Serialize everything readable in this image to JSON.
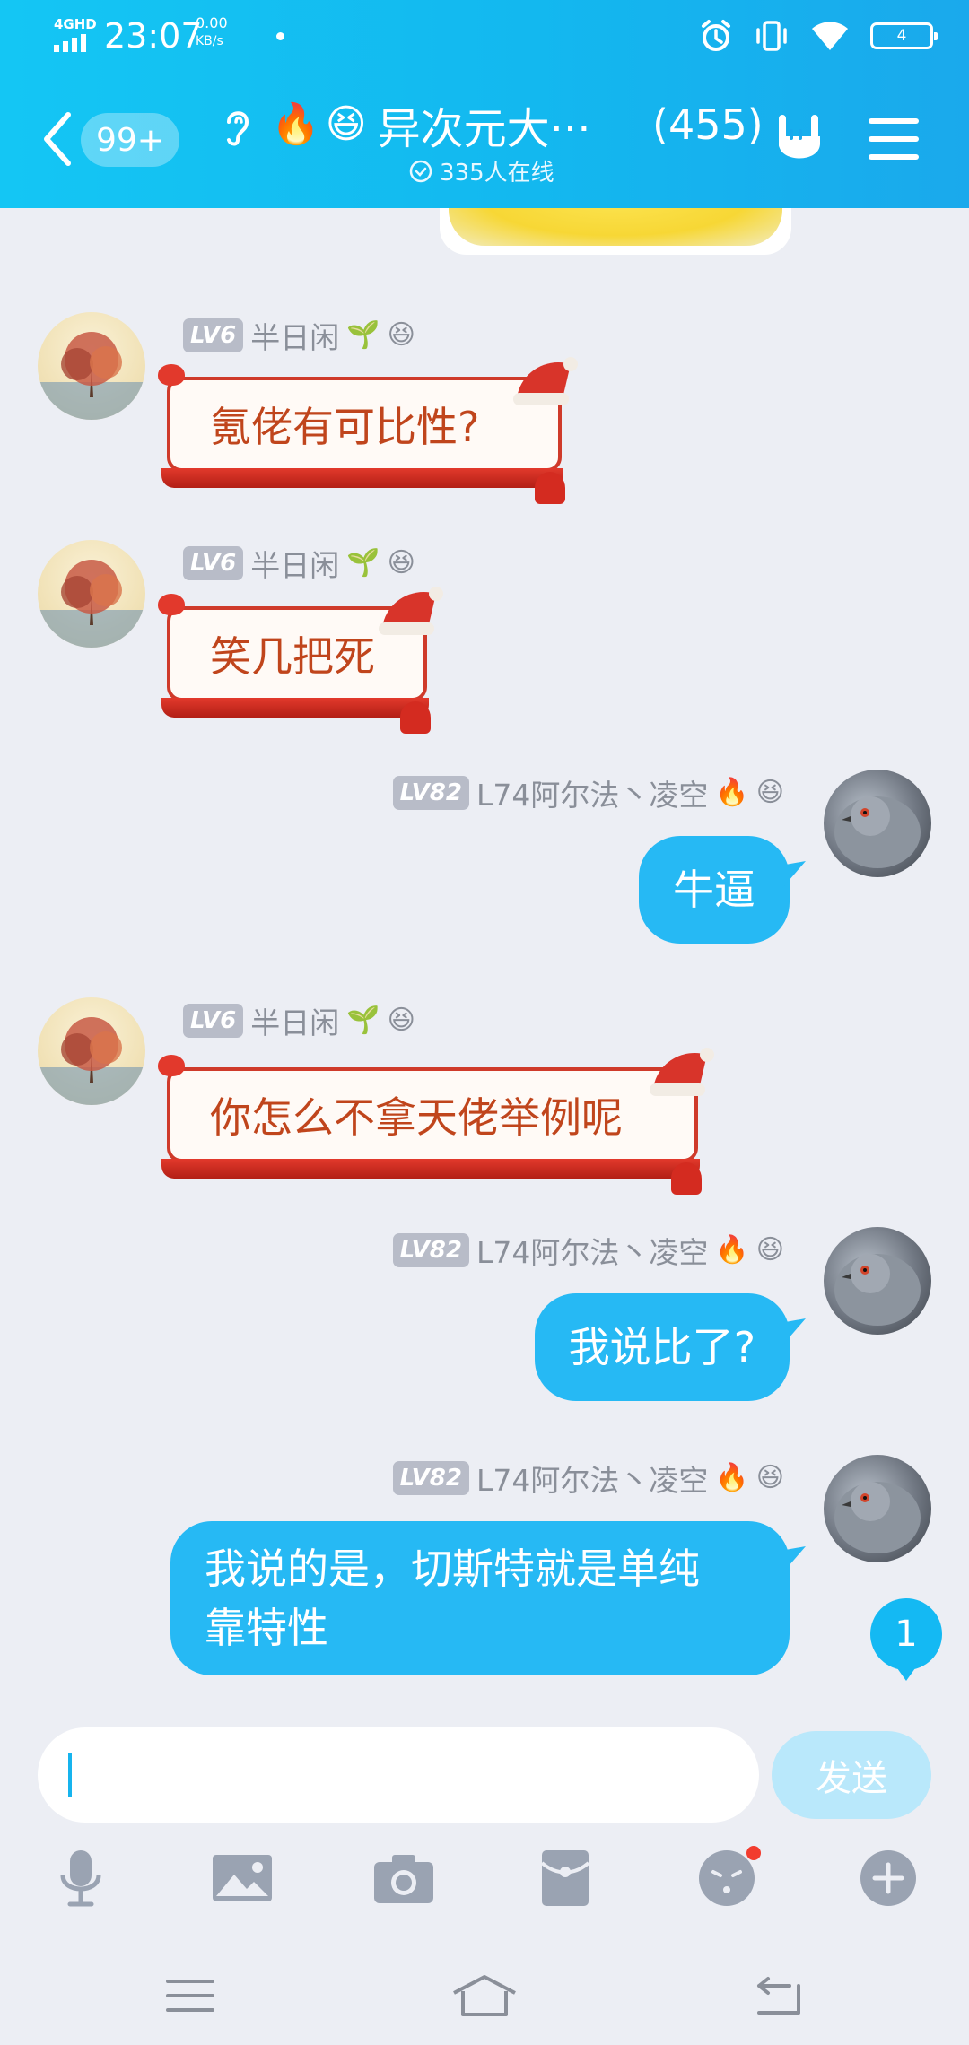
{
  "status_bar": {
    "network": "4GHD",
    "time": "23:07",
    "speed_value": "0.00",
    "speed_unit": "KB/s",
    "battery": "4"
  },
  "header": {
    "unread": "99+",
    "title_emoji_1": "🔥",
    "title_emoji_2": "😆",
    "group_name": "异次元大···",
    "member_count": "(455)",
    "online_text": "335人在线"
  },
  "messages": [
    {
      "side": "left",
      "level": "LV6",
      "sender": "半日闲",
      "badge_1": "🌱",
      "badge_2": "😆",
      "text": "氪佬有可比性?"
    },
    {
      "side": "left",
      "level": "LV6",
      "sender": "半日闲",
      "badge_1": "🌱",
      "badge_2": "😆",
      "text": "笑几把死"
    },
    {
      "side": "right",
      "level": "LV82",
      "sender": "L74阿尔法丶凌空",
      "badge_1": "🔥",
      "badge_2": "😆",
      "text": "牛逼"
    },
    {
      "side": "left",
      "level": "LV6",
      "sender": "半日闲",
      "badge_1": "🌱",
      "badge_2": "😆",
      "text": "你怎么不拿天佬举例呢"
    },
    {
      "side": "right",
      "level": "LV82",
      "sender": "L74阿尔法丶凌空",
      "badge_1": "🔥",
      "badge_2": "😆",
      "text": "我说比了?"
    },
    {
      "side": "right",
      "level": "LV82",
      "sender": "L74阿尔法丶凌空",
      "badge_1": "🔥",
      "badge_2": "😆",
      "text_line_1": "我说的是，切斯特就是单纯",
      "text_line_2": "靠特性"
    }
  ],
  "new_message_badge": "1",
  "input": {
    "value": "",
    "placeholder": "",
    "send_label": "发送"
  },
  "toolbar": [
    "microphone-icon",
    "image-icon",
    "camera-icon",
    "red-packet-icon",
    "emoji-icon",
    "plus-icon"
  ],
  "colors": {
    "header": "#13b8ef",
    "bubble_blue": "#26b9f4",
    "festive_text": "#c0451c",
    "festive_border": "#cf3a2a"
  }
}
